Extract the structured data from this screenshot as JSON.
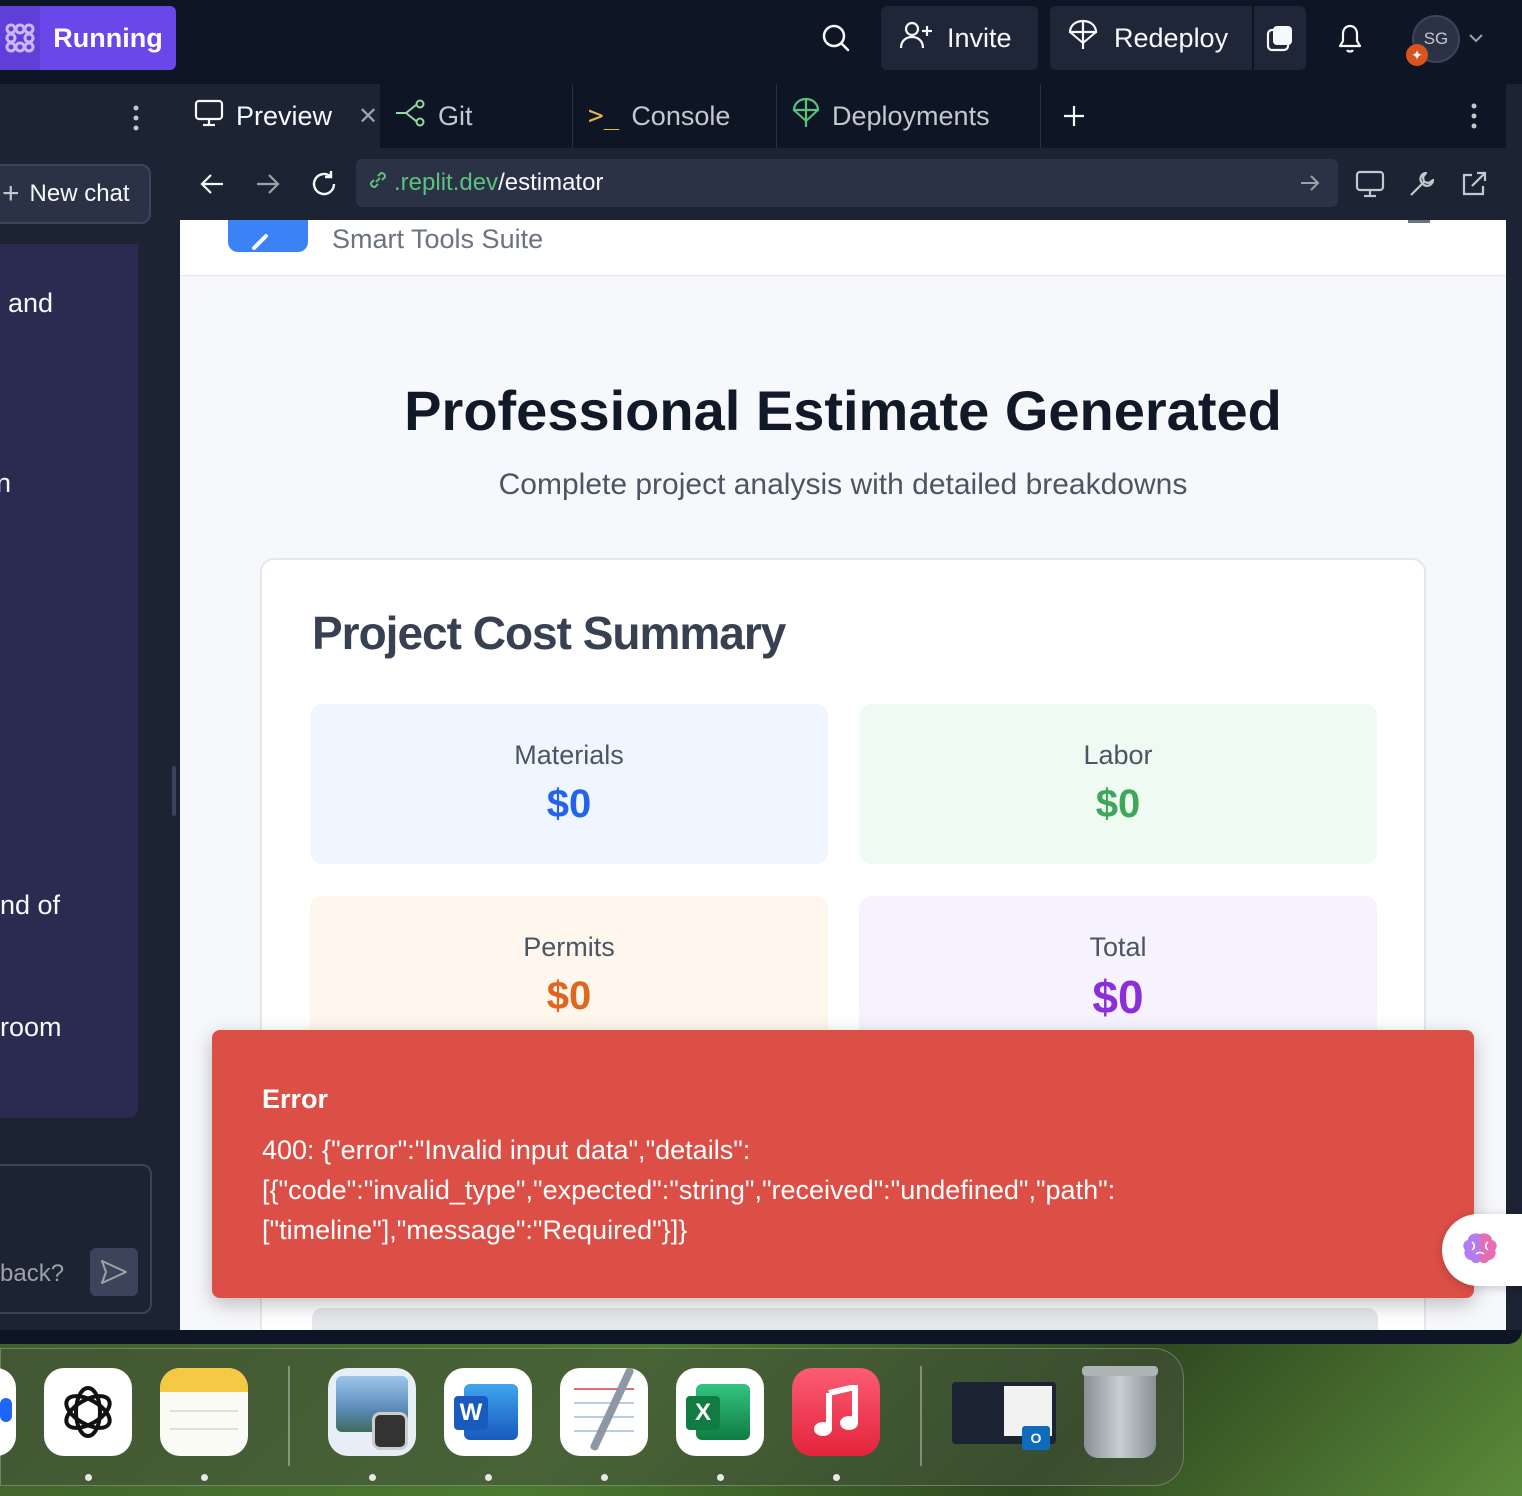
{
  "topbar": {
    "run_status": "Running",
    "invite_label": "Invite",
    "redeploy_label": "Redeploy",
    "avatar_initials": "SG"
  },
  "left_panel": {
    "new_chat_label": "New chat",
    "chat_fragments": [
      "and",
      "n",
      "nd of",
      "room"
    ],
    "input_placeholder": "back?"
  },
  "tabs": [
    {
      "label": "Preview",
      "icon": "monitor-icon",
      "active": true
    },
    {
      "label": "Git",
      "icon": "git-branch-icon",
      "active": false
    },
    {
      "label": "Console",
      "icon": "terminal-icon",
      "active": false
    },
    {
      "label": "Deployments",
      "icon": "deploy-icon",
      "active": false
    }
  ],
  "browser": {
    "url_domain": ".replit.dev",
    "url_path": "/estimator"
  },
  "app": {
    "subtitle": "Smart Tools Suite",
    "hero_title": "Professional Estimate Generated",
    "hero_subtitle": "Complete project analysis with detailed breakdowns",
    "summary_title": "Project Cost Summary",
    "costs": [
      {
        "label": "Materials",
        "value": "$0",
        "color": "#2563eb",
        "bg": "#eff6ff"
      },
      {
        "label": "Labor",
        "value": "$0",
        "color": "#3fa75a",
        "bg": "#effaf3"
      },
      {
        "label": "Permits",
        "value": "$0",
        "color": "#e0651d",
        "bg": "#fff7ed"
      },
      {
        "label": "Total",
        "value": "$0",
        "color": "#8b2fd9",
        "bg": "#f6f3fe"
      }
    ]
  },
  "error": {
    "title": "Error",
    "message": "400: {\"error\":\"Invalid input data\",\"details\":\n[{\"code\":\"invalid_type\",\"expected\":\"string\",\"received\":\"undefined\",\"path\":\n[\"timeline\"],\"message\":\"Required\"}]}"
  },
  "dock": {
    "apps": [
      "ChatGPT",
      "Notes",
      "Preview",
      "Microsoft Word",
      "TextEdit",
      "Microsoft Excel",
      "Music",
      "Outlook window",
      "Trash"
    ]
  }
}
